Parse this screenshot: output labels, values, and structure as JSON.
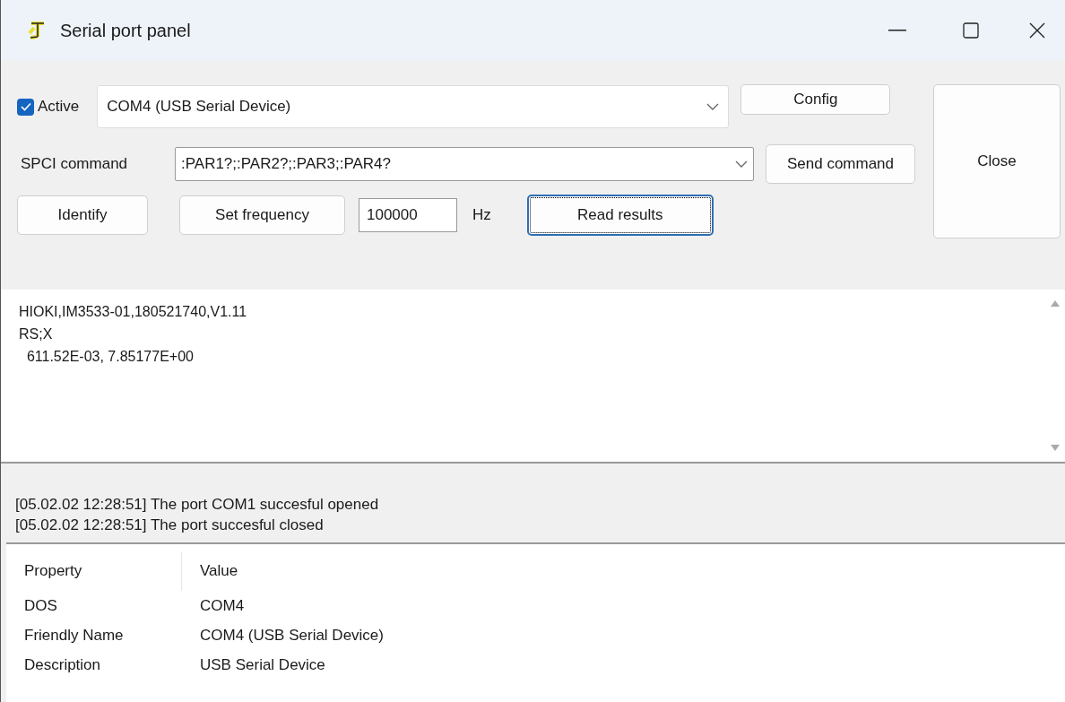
{
  "window": {
    "title": "Serial port panel"
  },
  "active": {
    "label": "Active",
    "checked": true
  },
  "port_select": {
    "value": "COM4 (USB Serial Device)"
  },
  "config_button": {
    "label": "Config",
    "focused": false
  },
  "close_button": {
    "label": "Close",
    "focused": false
  },
  "command": {
    "label": "SPCI command",
    "value": ":PAR1?;:PAR2?;:PAR3;:PAR4?"
  },
  "send_button": {
    "label": "Send command",
    "focused": false
  },
  "identify_button": {
    "label": "Identify",
    "focused": false
  },
  "frequency_button": {
    "label": "Set frequency",
    "focused": false
  },
  "frequency": {
    "value": "100000",
    "unit": "Hz"
  },
  "read_button": {
    "label": "Read results",
    "focused": true
  },
  "output_lines": [
    "HIOKI,IM3533-01,180521740,V1.11",
    "RS;X",
    "  611.52E-03, 7.85177E+00"
  ],
  "log_lines": [
    "[05.02.02 12:28:51] The port COM1 succesful opened",
    "[05.02.02 12:28:51] The port succesful closed"
  ],
  "table": {
    "columns": [
      "Property",
      "Value"
    ],
    "rows": [
      [
        "DOS",
        "COM4"
      ],
      [
        "Friendly Name",
        "COM4 (USB Serial Device)"
      ],
      [
        "Description",
        "USB Serial Device"
      ]
    ]
  }
}
